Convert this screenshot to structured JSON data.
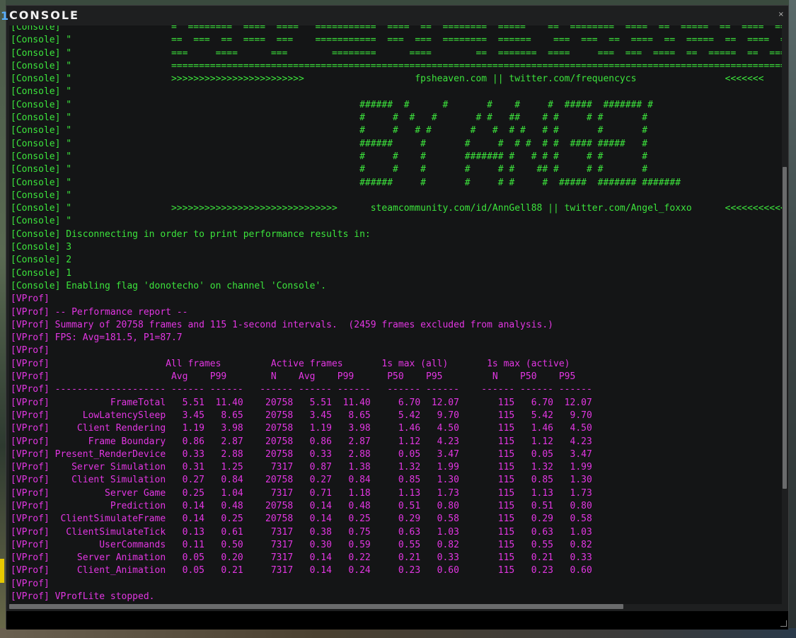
{
  "window": {
    "number": "1",
    "title": "CONSOLE",
    "close_label": "×"
  },
  "colors": {
    "console": "#3ce43c",
    "vprof": "#e236e2",
    "background": "#141516"
  },
  "icons": {
    "close": "close-icon"
  },
  "log": [
    {
      "channel": "console",
      "text": "[Console] \"                  =  ========  ====  ====   ===========  ====  ==  ========  =====    ==  ========  ====  ==  =====  ==  ====  =="
    },
    {
      "channel": "console",
      "text": "[Console] \"                  ==  ===  ==  ====  ===    ===========  ===  ===  ========  ======    ===  ===  ==  ====  ==  =====  ==  ====  =="
    },
    {
      "channel": "console",
      "text": "[Console] \"                  ===     ====      ===        ========      ====        ==  =======  ====     ===  ===  ====  ==  =====  ==  ====  =="
    },
    {
      "channel": "console",
      "text": "[Console] \"                  =================================================================================================================="
    },
    {
      "channel": "console",
      "text": "[Console] \"                  >>>>>>>>>>>>>>>>>>>>>>>>                    fpsheaven.com || twitter.com/frequencycs                <<<<<<<"
    },
    {
      "channel": "console",
      "text": "[Console] \""
    },
    {
      "channel": "console",
      "text": "[Console] \"                                                    ######  #      #       #    #     #  #####  ####### #"
    },
    {
      "channel": "console",
      "text": "[Console] \"                                                    #     #  #   #       # #   ##    # #     # #       #"
    },
    {
      "channel": "console",
      "text": "[Console] \"                                                    #     #   # #       #   #  # #   # #       #       #"
    },
    {
      "channel": "console",
      "text": "[Console] \"                                                    ######     #       #     #  # #  # #  #### #####   #"
    },
    {
      "channel": "console",
      "text": "[Console] \"                                                    #     #    #       ####### #   # # #     # #       #"
    },
    {
      "channel": "console",
      "text": "[Console] \"                                                    #     #    #       #     # #    ## #     # #       #"
    },
    {
      "channel": "console",
      "text": "[Console] \"                                                    ######     #       #     # #     #  #####  ####### #######"
    },
    {
      "channel": "console",
      "text": "[Console] \""
    },
    {
      "channel": "console",
      "text": "[Console] \"                  >>>>>>>>>>>>>>>>>>>>>>>>>>>>>>      steamcommunity.com/id/AnnGell88 || twitter.com/Angel_foxxo      <<<<<<<<<<<<"
    },
    {
      "channel": "console",
      "text": "[Console] \""
    },
    {
      "channel": "console",
      "text": "[Console] Disconnecting in order to print performance results in:"
    },
    {
      "channel": "console",
      "text": "[Console] 3"
    },
    {
      "channel": "console",
      "text": "[Console] 2"
    },
    {
      "channel": "console",
      "text": "[Console] 1"
    },
    {
      "channel": "console",
      "text": "[Console] Enabling flag 'donotecho' on channel 'Console'."
    },
    {
      "channel": "vprof",
      "text": "[VProf]"
    },
    {
      "channel": "vprof",
      "text": "[VProf] -- Performance report --"
    },
    {
      "channel": "vprof",
      "text": "[VProf] Summary of 20758 frames and 115 1-second intervals.  (2459 frames excluded from analysis.)"
    },
    {
      "channel": "vprof",
      "text": "[VProf] FPS: Avg=181.5, P1=87.7"
    },
    {
      "channel": "vprof",
      "text": "[VProf]"
    },
    {
      "channel": "vprof",
      "text": "[VProf]                     All frames         Active frames       1s max (all)       1s max (active)"
    },
    {
      "channel": "vprof",
      "text": "[VProf]                      Avg    P99        N    Avg    P99      P50    P95         N    P50    P95"
    },
    {
      "channel": "vprof",
      "text": "[VProf] -------------------- ------ ------   ------ ------ ------   ------ ------    ------ ------ ------"
    },
    {
      "channel": "vprof",
      "text": "[VProf]           FrameTotal   5.51  11.40    20758   5.51  11.40     6.70  12.07       115   6.70  12.07"
    },
    {
      "channel": "vprof",
      "text": "[VProf]      LowLatencySleep   3.45   8.65    20758   3.45   8.65     5.42   9.70       115   5.42   9.70"
    },
    {
      "channel": "vprof",
      "text": "[VProf]     Client Rendering   1.19   3.98    20758   1.19   3.98     1.46   4.50       115   1.46   4.50"
    },
    {
      "channel": "vprof",
      "text": "[VProf]       Frame Boundary   0.86   2.87    20758   0.86   2.87     1.12   4.23       115   1.12   4.23"
    },
    {
      "channel": "vprof",
      "text": "[VProf] Present_RenderDevice   0.33   2.88    20758   0.33   2.88     0.05   3.47       115   0.05   3.47"
    },
    {
      "channel": "vprof",
      "text": "[VProf]    Server Simulation   0.31   1.25     7317   0.87   1.38     1.32   1.99       115   1.32   1.99"
    },
    {
      "channel": "vprof",
      "text": "[VProf]    Client Simulation   0.27   0.84    20758   0.27   0.84     0.85   1.30       115   0.85   1.30"
    },
    {
      "channel": "vprof",
      "text": "[VProf]          Server Game   0.25   1.04     7317   0.71   1.18     1.13   1.73       115   1.13   1.73"
    },
    {
      "channel": "vprof",
      "text": "[VProf]           Prediction   0.14   0.48    20758   0.14   0.48     0.51   0.80       115   0.51   0.80"
    },
    {
      "channel": "vprof",
      "text": "[VProf]  ClientSimulateFrame   0.14   0.25    20758   0.14   0.25     0.29   0.58       115   0.29   0.58"
    },
    {
      "channel": "vprof",
      "text": "[VProf]   ClientSimulateTick   0.13   0.61     7317   0.38   0.75     0.63   1.03       115   0.63   1.03"
    },
    {
      "channel": "vprof",
      "text": "[VProf]         UserCommands   0.11   0.50     7317   0.30   0.59     0.55   0.82       115   0.55   0.82"
    },
    {
      "channel": "vprof",
      "text": "[VProf]     Server Animation   0.05   0.20     7317   0.14   0.22     0.21   0.33       115   0.21   0.33"
    },
    {
      "channel": "vprof",
      "text": "[VProf]     Client_Animation   0.05   0.21     7317   0.14   0.24     0.23   0.60       115   0.23   0.60"
    },
    {
      "channel": "vprof",
      "text": "[VProf]"
    },
    {
      "channel": "vprof",
      "text": "[VProf] VProfLite stopped."
    }
  ],
  "input": {
    "value": "",
    "placeholder": ""
  }
}
